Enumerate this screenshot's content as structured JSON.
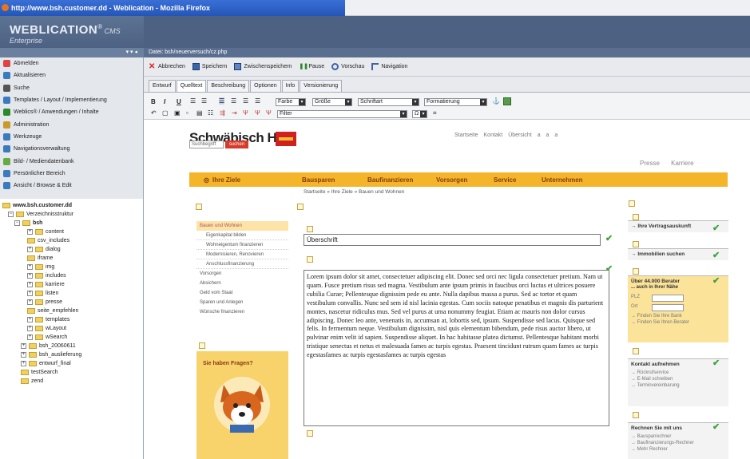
{
  "window": {
    "title": "http://www.bsh.customer.dd - Weblication - Mozilla Firefox"
  },
  "brand": {
    "name": "WEBLICATION",
    "reg": "®",
    "sub": "CMS Enterprise"
  },
  "nav": {
    "items": [
      {
        "label": "Abmelden",
        "icon": "logout-icon"
      },
      {
        "label": "Aktualisieren",
        "icon": "refresh-icon"
      },
      {
        "label": "Suche",
        "icon": "search-icon"
      },
      {
        "label": "Templates / Layout / Implementierung",
        "icon": "template-icon"
      },
      {
        "label": "Weblics® / Anwendungen / Inhalte",
        "icon": "apps-icon"
      },
      {
        "label": "Administration",
        "icon": "admin-icon"
      },
      {
        "label": "Werkzeuge",
        "icon": "tools-icon"
      },
      {
        "label": "Navigationsverwaltung",
        "icon": "navigation-icon"
      },
      {
        "label": "Bild- / Mediendatenbank",
        "icon": "media-icon"
      },
      {
        "label": "Persönlicher Bereich",
        "icon": "personal-icon"
      },
      {
        "label": "Ansicht / Browse & Edit",
        "icon": "view-icon"
      }
    ]
  },
  "tree": {
    "root": "www.bsh.customer.dd",
    "struct": "Verzeichnisstruktur",
    "rows": [
      "bsh",
      "content",
      "csv_includes",
      "dialog",
      "iframe",
      "img",
      "includes",
      "karriere",
      "listen",
      "presse",
      "seite_empfehlen",
      "templates",
      "wLayout",
      "wSearch",
      "bsh_20060611",
      "bsh_auslieferung",
      "entwurf_final",
      "testSearch",
      "zend"
    ]
  },
  "editor": {
    "path": "Datei: bsh/neuerversuch/cz.php",
    "toolbar": [
      "Abbrechen",
      "Speichern",
      "Zwischenspeichern",
      "Pause",
      "Vorschau",
      "Navigation"
    ],
    "tabs": [
      "Entwurf",
      "Quelltext",
      "Beschreibung",
      "Optionen",
      "Info",
      "Versionierung"
    ],
    "fmt": {
      "farbe": "Farbe",
      "groesse": "Größe",
      "schriftart": "Schriftart",
      "formatierung": "Formatierung",
      "filter": "Filter",
      "omega": "Ω"
    }
  },
  "site": {
    "logo": "Schwäbisch Hall",
    "search_placeholder": "Suchbegriff",
    "search_button": "suchen",
    "toplinks": "Startseite Kontakt Übersicht a a a",
    "presse": "Presse Karriere",
    "menu": [
      "Ihre Ziele",
      "Bausparen",
      "Baufinanzieren",
      "Vorsorgen",
      "Service",
      "Unternehmen"
    ],
    "breadcrumb": "Startseite » Ihre Ziele » Bauen und Wohnen",
    "leftnav": [
      {
        "label": "Bauen und Wohnen",
        "kind": "act"
      },
      {
        "label": "Eigenkapital bilden",
        "kind": "sub"
      },
      {
        "label": "Wohneigentum finanzieren",
        "kind": "sub"
      },
      {
        "label": "Modernisieren, Renovieren",
        "kind": "sub"
      },
      {
        "label": "Anschlussfinanzierung",
        "kind": "sub"
      },
      {
        "label": "Vorsorgen",
        "kind": ""
      },
      {
        "label": "Absichern",
        "kind": ""
      },
      {
        "label": "Geld vom Staat",
        "kind": ""
      },
      {
        "label": "Sparen und Anlegen",
        "kind": ""
      },
      {
        "label": "Wünsche finanzieren",
        "kind": ""
      }
    ],
    "question": "Sie haben Fragen?",
    "headline": "Überschrift",
    "body": "Lorem ipsum dolor sit amet, consectetuer adipiscing elit. Donec sed orci nec ligula consectetuer pretium. Nam ut quam. Fusce pretium risus sed magna. Vestibulum ante ipsum primis in faucibus orci luctus et ultrices posuere cubilia Curae; Pellentesque dignissim pede eu ante. Nulla dapibus massa a purus. Sed ac tortor et quam vestibulum convallis. Nunc sed sem id nisl lacinia egestas. Cum sociis natoque penatibus et magnis dis parturient montes, nascetur ridiculus mus. Sed vel purus at urna nonummy feugiat. Etiam ac mauris non dolor cursus adipiscing. Donec leo ante, venenatis in, accumsan at, lobortis sed, ipsum. Suspendisse sed lacus. Quisque sed felis. In fermentum neque. Vestibulum dignissim, nisl quis elementum bibendum, pede risus auctor libero, ut pulvinar enim velit id sapien. Suspendisse aliquet. In hac habitasse platea dictumst. Pellentesque habitant morbi tristique senectus et netus et malesuada fames ac turpis egestas. Praesent tincidunt rutrum quam fames ac turpis egestasfames ac turpis egestasfames ac turpis egestas",
    "right": {
      "vertrag": "Ihre Vertragsauskunft",
      "immobilien": "Immobilien suchen",
      "berater_title": "Über 44.000 Berater",
      "berater_sub": "... auch in Ihrer Nähe",
      "plz": "PLZ",
      "ort": "Ort",
      "bank": "Finden Sie Ihre Bank",
      "berater_find": "Finden Sie Ihren Berater",
      "kontakt": "Kontakt aufnehmen",
      "kontakt_items": [
        "Rückrufservice",
        "E-Mail schreiben",
        "Terminvereinbarung"
      ],
      "rechnen": "Rechnen Sie mit uns",
      "rechnen_items": [
        "Bausparrechner",
        "Baufinanzierungs-Rechner",
        "Mehr Rechner"
      ]
    }
  },
  "colors": {
    "menu": "#f4b52a",
    "brand": "#4d6283",
    "check": "#3aa33a"
  }
}
